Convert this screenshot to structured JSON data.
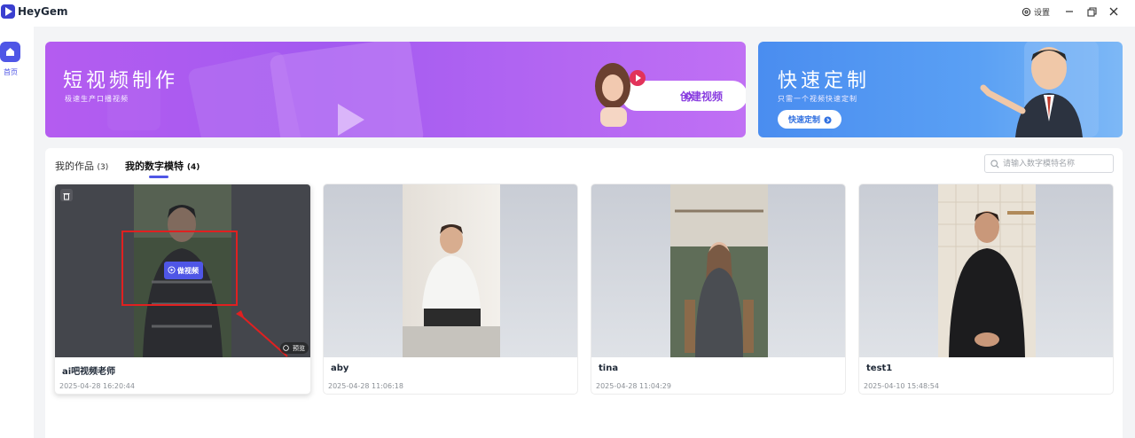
{
  "app": {
    "title": "HeyGem"
  },
  "titlebar": {
    "settings_label": "设置",
    "settings_icon": "gear-icon",
    "minimize_icon": "minimize-icon",
    "restore_icon": "restore-icon",
    "close_icon": "close-icon"
  },
  "sidebar": {
    "items": [
      {
        "label": "首页",
        "icon": "home-icon",
        "active": true
      }
    ]
  },
  "banners": {
    "short_video": {
      "title": "短视频制作",
      "subtitle": "极速生产口播视频",
      "button_label": "创建视频"
    },
    "quick_custom": {
      "title": "快速定制",
      "subtitle": "只需一个视频快速定制",
      "button_label": "快速定制"
    }
  },
  "tabs": [
    {
      "label": "我的作品",
      "count": "(3)",
      "active": false
    },
    {
      "label": "我的数字模特",
      "count": "(4)",
      "active": true
    }
  ],
  "search": {
    "placeholder": "请输入数字模特名称"
  },
  "models": [
    {
      "name": "ai吧视频老师",
      "date": "2025-04-28 16:20:44",
      "hovered": true
    },
    {
      "name": "aby",
      "date": "2025-04-28 11:06:18"
    },
    {
      "name": "tina",
      "date": "2025-04-28 11:04:29"
    },
    {
      "name": "test1",
      "date": "2025-04-10 15:48:54"
    }
  ],
  "card_actions": {
    "make_video_label": "做视频",
    "preview_label": "预览"
  },
  "colors": {
    "accent": "#4f56e6",
    "banner_purple": "#a35af0",
    "banner_blue": "#4a8df0",
    "annotation_red": "#e02020"
  }
}
